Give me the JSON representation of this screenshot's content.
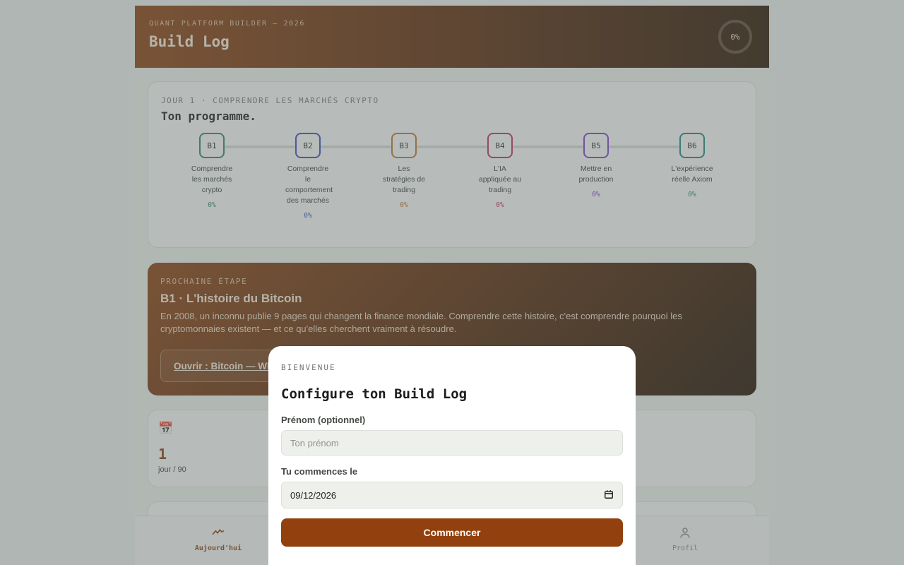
{
  "header": {
    "eyebrow": "QUANT PLATFORM BUILDER — 2026",
    "title": "Build Log",
    "progress_label": "0%",
    "progress_fraction": 0
  },
  "program": {
    "eyebrow": "JOUR 1 · COMPRENDRE LES MARCHÉS CRYPTO",
    "title": "Ton programme.",
    "steps": [
      {
        "code": "B1",
        "label": "Comprendre les marchés crypto",
        "pct": "0%",
        "color": "#2d8a68"
      },
      {
        "code": "B2",
        "label": "Comprendre le comportement des marchés",
        "pct": "0%",
        "color": "#3b4fc4"
      },
      {
        "code": "B3",
        "label": "Les stratégies de trading",
        "pct": "0%",
        "color": "#c07a2a"
      },
      {
        "code": "B4",
        "label": "L'IA appliquée au trading",
        "pct": "0%",
        "color": "#c0365a"
      },
      {
        "code": "B5",
        "label": "Mettre en production",
        "pct": "0%",
        "color": "#7e45c6"
      },
      {
        "code": "B6",
        "label": "L'expérience réelle Axiom",
        "pct": "0%",
        "color": "#1f8a82"
      }
    ]
  },
  "next_step": {
    "eyebrow": "PROCHAINE ÉTAPE",
    "title": "B1 · L'histoire du Bitcoin",
    "description": "En 2008, un inconnu publie 9 pages qui changent la finance mondiale. Comprendre cette histoire, c'est comprendre pourquoi les cryptomonnaies existent — et ce qu'elles cherchent vraiment à résoudre.",
    "button_label": "Ouvrir : Bitcoin — Wh"
  },
  "stats": {
    "icon": "calendar-icon",
    "value": "1",
    "unit": "jour / 90"
  },
  "bottom_nav": {
    "items": [
      {
        "label": "Aujourd'hui",
        "icon": "activity-icon",
        "active": true
      },
      {
        "label": "Profil",
        "icon": "user-icon",
        "active": false
      }
    ]
  },
  "modal": {
    "eyebrow": "BIENVENUE",
    "title": "Configure ton Build Log",
    "name_label": "Prénom (optionnel)",
    "name_placeholder": "Ton prénom",
    "date_label": "Tu commences le",
    "date_value": "09/12/2026",
    "submit_label": "Commencer"
  },
  "colors": {
    "accent": "#92400e",
    "header_gradient_start": "#8e4212",
    "header_gradient_end": "#2e1707"
  }
}
